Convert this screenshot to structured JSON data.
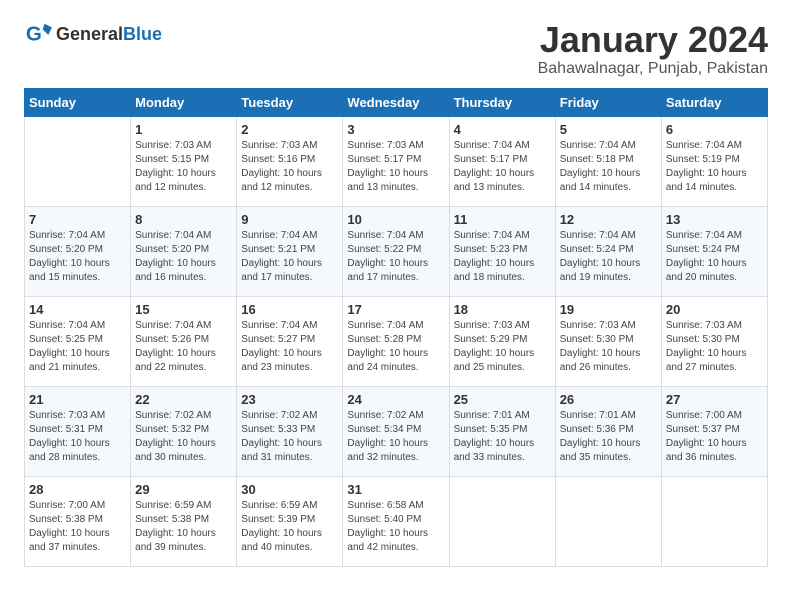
{
  "logo": {
    "general": "General",
    "blue": "Blue"
  },
  "header": {
    "month_year": "January 2024",
    "location": "Bahawalnagar, Punjab, Pakistan"
  },
  "weekdays": [
    "Sunday",
    "Monday",
    "Tuesday",
    "Wednesday",
    "Thursday",
    "Friday",
    "Saturday"
  ],
  "weeks": [
    {
      "row_class": "odd-row",
      "days": [
        {
          "num": "",
          "info": ""
        },
        {
          "num": "1",
          "info": "Sunrise: 7:03 AM\nSunset: 5:15 PM\nDaylight: 10 hours\nand 12 minutes."
        },
        {
          "num": "2",
          "info": "Sunrise: 7:03 AM\nSunset: 5:16 PM\nDaylight: 10 hours\nand 12 minutes."
        },
        {
          "num": "3",
          "info": "Sunrise: 7:03 AM\nSunset: 5:17 PM\nDaylight: 10 hours\nand 13 minutes."
        },
        {
          "num": "4",
          "info": "Sunrise: 7:04 AM\nSunset: 5:17 PM\nDaylight: 10 hours\nand 13 minutes."
        },
        {
          "num": "5",
          "info": "Sunrise: 7:04 AM\nSunset: 5:18 PM\nDaylight: 10 hours\nand 14 minutes."
        },
        {
          "num": "6",
          "info": "Sunrise: 7:04 AM\nSunset: 5:19 PM\nDaylight: 10 hours\nand 14 minutes."
        }
      ]
    },
    {
      "row_class": "even-row",
      "days": [
        {
          "num": "7",
          "info": "Sunrise: 7:04 AM\nSunset: 5:20 PM\nDaylight: 10 hours\nand 15 minutes."
        },
        {
          "num": "8",
          "info": "Sunrise: 7:04 AM\nSunset: 5:20 PM\nDaylight: 10 hours\nand 16 minutes."
        },
        {
          "num": "9",
          "info": "Sunrise: 7:04 AM\nSunset: 5:21 PM\nDaylight: 10 hours\nand 17 minutes."
        },
        {
          "num": "10",
          "info": "Sunrise: 7:04 AM\nSunset: 5:22 PM\nDaylight: 10 hours\nand 17 minutes."
        },
        {
          "num": "11",
          "info": "Sunrise: 7:04 AM\nSunset: 5:23 PM\nDaylight: 10 hours\nand 18 minutes."
        },
        {
          "num": "12",
          "info": "Sunrise: 7:04 AM\nSunset: 5:24 PM\nDaylight: 10 hours\nand 19 minutes."
        },
        {
          "num": "13",
          "info": "Sunrise: 7:04 AM\nSunset: 5:24 PM\nDaylight: 10 hours\nand 20 minutes."
        }
      ]
    },
    {
      "row_class": "odd-row",
      "days": [
        {
          "num": "14",
          "info": "Sunrise: 7:04 AM\nSunset: 5:25 PM\nDaylight: 10 hours\nand 21 minutes."
        },
        {
          "num": "15",
          "info": "Sunrise: 7:04 AM\nSunset: 5:26 PM\nDaylight: 10 hours\nand 22 minutes."
        },
        {
          "num": "16",
          "info": "Sunrise: 7:04 AM\nSunset: 5:27 PM\nDaylight: 10 hours\nand 23 minutes."
        },
        {
          "num": "17",
          "info": "Sunrise: 7:04 AM\nSunset: 5:28 PM\nDaylight: 10 hours\nand 24 minutes."
        },
        {
          "num": "18",
          "info": "Sunrise: 7:03 AM\nSunset: 5:29 PM\nDaylight: 10 hours\nand 25 minutes."
        },
        {
          "num": "19",
          "info": "Sunrise: 7:03 AM\nSunset: 5:30 PM\nDaylight: 10 hours\nand 26 minutes."
        },
        {
          "num": "20",
          "info": "Sunrise: 7:03 AM\nSunset: 5:30 PM\nDaylight: 10 hours\nand 27 minutes."
        }
      ]
    },
    {
      "row_class": "even-row",
      "days": [
        {
          "num": "21",
          "info": "Sunrise: 7:03 AM\nSunset: 5:31 PM\nDaylight: 10 hours\nand 28 minutes."
        },
        {
          "num": "22",
          "info": "Sunrise: 7:02 AM\nSunset: 5:32 PM\nDaylight: 10 hours\nand 30 minutes."
        },
        {
          "num": "23",
          "info": "Sunrise: 7:02 AM\nSunset: 5:33 PM\nDaylight: 10 hours\nand 31 minutes."
        },
        {
          "num": "24",
          "info": "Sunrise: 7:02 AM\nSunset: 5:34 PM\nDaylight: 10 hours\nand 32 minutes."
        },
        {
          "num": "25",
          "info": "Sunrise: 7:01 AM\nSunset: 5:35 PM\nDaylight: 10 hours\nand 33 minutes."
        },
        {
          "num": "26",
          "info": "Sunrise: 7:01 AM\nSunset: 5:36 PM\nDaylight: 10 hours\nand 35 minutes."
        },
        {
          "num": "27",
          "info": "Sunrise: 7:00 AM\nSunset: 5:37 PM\nDaylight: 10 hours\nand 36 minutes."
        }
      ]
    },
    {
      "row_class": "odd-row",
      "days": [
        {
          "num": "28",
          "info": "Sunrise: 7:00 AM\nSunset: 5:38 PM\nDaylight: 10 hours\nand 37 minutes."
        },
        {
          "num": "29",
          "info": "Sunrise: 6:59 AM\nSunset: 5:38 PM\nDaylight: 10 hours\nand 39 minutes."
        },
        {
          "num": "30",
          "info": "Sunrise: 6:59 AM\nSunset: 5:39 PM\nDaylight: 10 hours\nand 40 minutes."
        },
        {
          "num": "31",
          "info": "Sunrise: 6:58 AM\nSunset: 5:40 PM\nDaylight: 10 hours\nand 42 minutes."
        },
        {
          "num": "",
          "info": ""
        },
        {
          "num": "",
          "info": ""
        },
        {
          "num": "",
          "info": ""
        }
      ]
    }
  ]
}
